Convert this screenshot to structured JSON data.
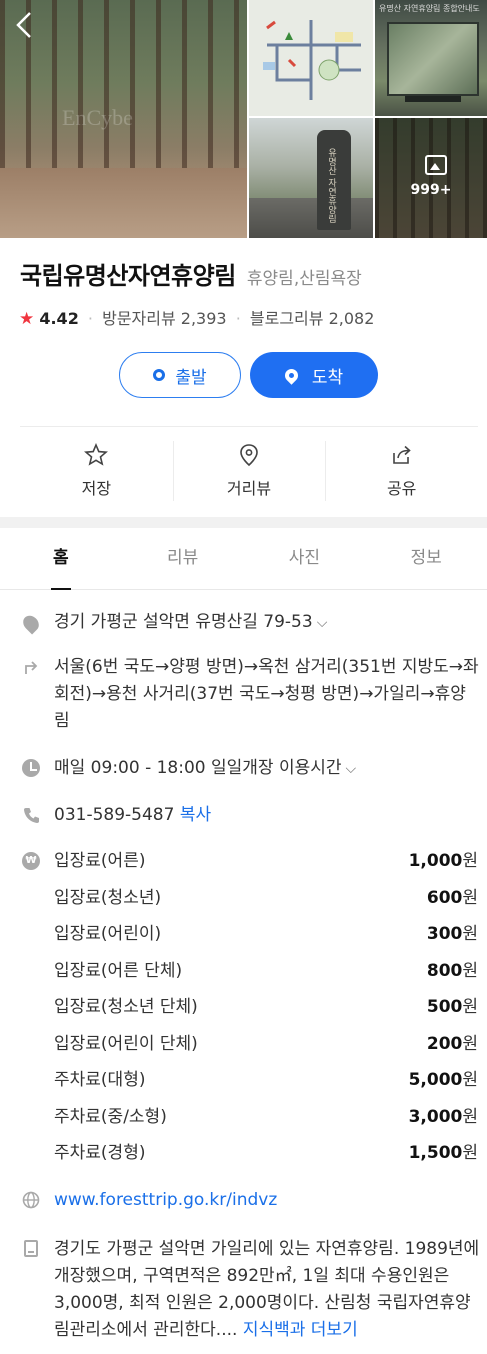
{
  "gallery": {
    "watermark": "EnCybe",
    "more_count": "999+",
    "board_caption": "유명산 자연휴양림 종합안내도",
    "stone_text": "유명산 자연휴양림"
  },
  "place": {
    "name": "국립유명산자연휴양림",
    "category": "휴양림,산림욕장",
    "rating": "4.42",
    "visitor_review": "방문자리뷰 2,393",
    "blog_review": "블로그리뷰 2,082"
  },
  "buttons": {
    "depart": "출발",
    "arrive": "도착"
  },
  "actions": {
    "save": "저장",
    "street_view": "거리뷰",
    "share": "공유"
  },
  "tabs": [
    "홈",
    "리뷰",
    "사진",
    "정보"
  ],
  "info": {
    "address": "경기 가평군 설악면 유명산길 79-53",
    "directions": "서울(6번 국도→양평 방면)→옥천 삼거리(351번 지방도→좌회전)→용천 사거리(37번 국도→청평 방면)→가일리→휴양림",
    "hours": "매일 09:00 - 18:00 일일개장 이용시간",
    "phone": "031-589-5487",
    "copy": "복사",
    "website": "www.foresttrip.go.kr/indvz",
    "description": "경기도 가평군 설악면 가일리에 있는 자연휴양림. 1989년에 개장했으며, 구역면적은 892만㎡, 1일 최대 수용인원은 3,000명, 최적 인원은 2,000명이다. 산림청 국립자연휴양림관리소에서 관리한다....",
    "more_link": "지식백과 더보기"
  },
  "fees": [
    {
      "label": "입장료(어른)",
      "amount": "1,000",
      "unit": "원"
    },
    {
      "label": "입장료(청소년)",
      "amount": "600",
      "unit": "원"
    },
    {
      "label": "입장료(어린이)",
      "amount": "300",
      "unit": "원"
    },
    {
      "label": "입장료(어른 단체)",
      "amount": "800",
      "unit": "원"
    },
    {
      "label": "입장료(청소년 단체)",
      "amount": "500",
      "unit": "원"
    },
    {
      "label": "입장료(어린이 단체)",
      "amount": "200",
      "unit": "원"
    },
    {
      "label": "주차료(대형)",
      "amount": "5,000",
      "unit": "원"
    },
    {
      "label": "주차료(중/소형)",
      "amount": "3,000",
      "unit": "원"
    },
    {
      "label": "주차료(경형)",
      "amount": "1,500",
      "unit": "원"
    }
  ]
}
